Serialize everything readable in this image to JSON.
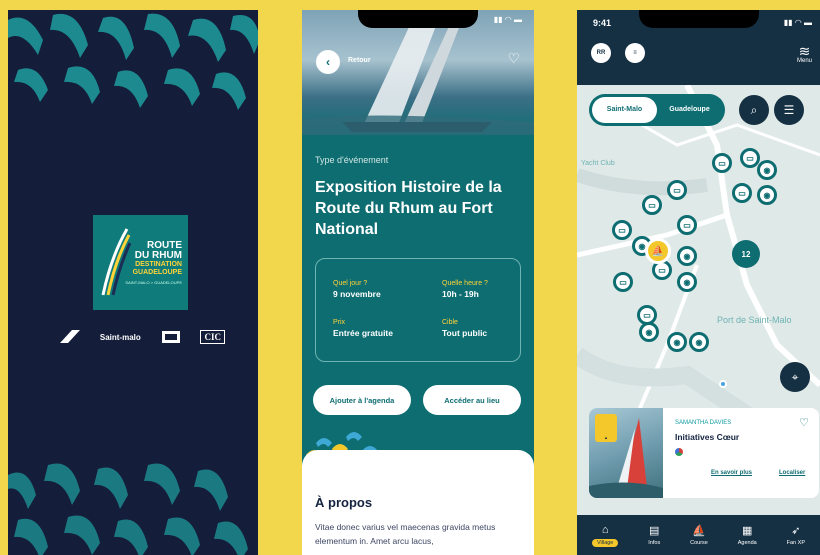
{
  "splash": {
    "logo_line1": "ROUTE",
    "logo_line2": "DU RHUM",
    "logo_line3": "DESTINATION",
    "logo_line4": "GUADELOUPE",
    "logo_line5": "SAINT-MALO > GUADELOUPE",
    "partners": [
      "Saint-malo",
      "CIC"
    ]
  },
  "event": {
    "back_label": "Retour",
    "type": "Type d'événement",
    "title": "Exposition Histoire de la Route du Rhum au Fort National",
    "info": [
      {
        "label": "Quel jour ?",
        "value": "9 novembre"
      },
      {
        "label": "Quelle heure ?",
        "value": "10h - 19h"
      },
      {
        "label": "Prix",
        "value": "Entrée gratuite"
      },
      {
        "label": "Cible",
        "value": "Tout public"
      }
    ],
    "btn_agenda": "Ajouter à l'agenda",
    "btn_place": "Accéder au lieu",
    "about_title": "À propos",
    "about_text": "Vitae donec varius vel maecenas gravida metus elementum in. Amet arcu lacus,"
  },
  "map": {
    "time": "9:41",
    "menu_label": "Menu",
    "segments": [
      "Saint-Malo",
      "Guadeloupe"
    ],
    "cluster_count": "12",
    "label_port": "Port de Saint-Malo",
    "label_club": "Yacht Club",
    "card": {
      "subtitle": "SAMANTHA DAVIES",
      "title": "Initiatives Cœur",
      "link_more": "En savoir plus",
      "link_locate": "Localiser"
    },
    "tabs": [
      "Village",
      "Infos",
      "Course",
      "Agenda",
      "Fan XP"
    ]
  },
  "colors": {
    "background": "#f2d64b",
    "navy": "#141d3a",
    "teal": "#0e6d71",
    "yellow": "#f4c72b"
  }
}
